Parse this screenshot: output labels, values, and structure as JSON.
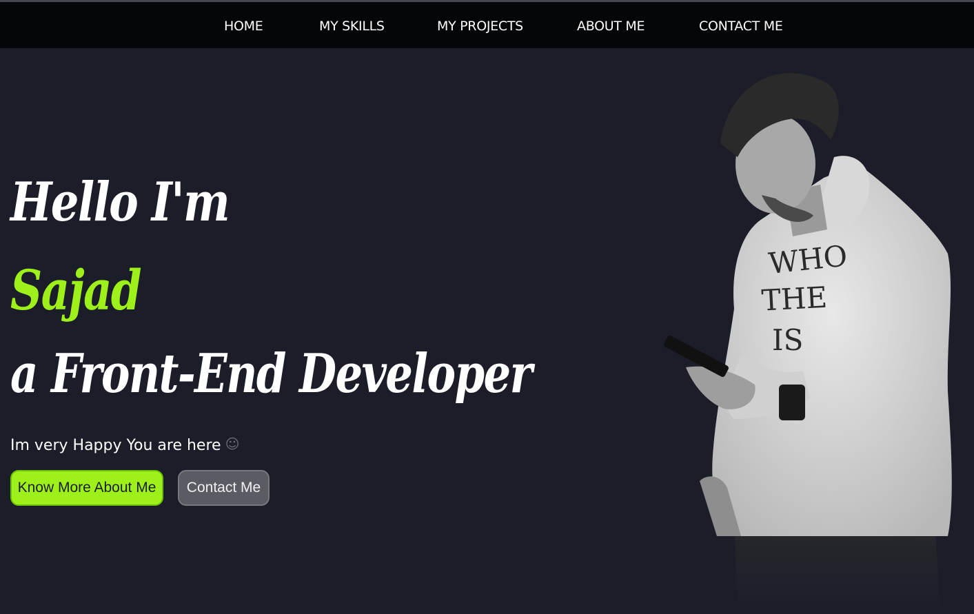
{
  "nav": {
    "items": [
      {
        "label": "HOME"
      },
      {
        "label": "MY SKILLS"
      },
      {
        "label": "MY PROJECTS"
      },
      {
        "label": "ABOUT ME"
      },
      {
        "label": "CONTACT ME"
      }
    ]
  },
  "hero": {
    "greeting": "Hello I'm",
    "name": "Sajad",
    "role": "a Front-End Developer",
    "subtitle": "Im very Happy You are here",
    "emoji": "☺",
    "primary_button": "Know More About Me",
    "secondary_button": "Contact Me",
    "portrait_icon": "person-photo-icon",
    "portrait_hoodie_text": [
      "WHO",
      "THE",
      "IS"
    ]
  },
  "colors": {
    "background": "#1b1d29",
    "navbar": "#050608",
    "accent": "#9ef01a",
    "secondary_button": "#5b5c63",
    "text": "#ffffff"
  }
}
